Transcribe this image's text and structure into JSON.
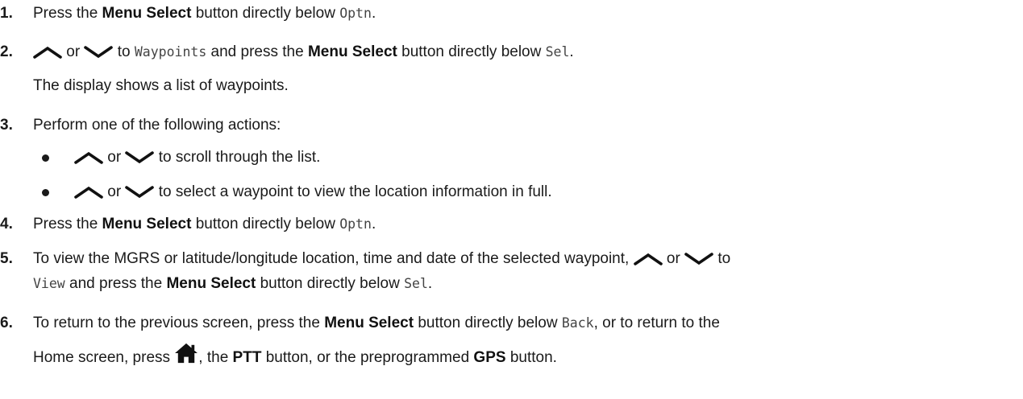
{
  "icons": {
    "up": "chevron-up-icon",
    "down": "chevron-down-icon",
    "home": "home-icon"
  },
  "steps": [
    {
      "number": "1.",
      "t1": "Press the ",
      "b1": "Menu Select",
      "t2": " button directly below ",
      "m1": "Optn",
      "t3": "."
    },
    {
      "number": "2.",
      "or": " or ",
      "t1": " to ",
      "m1": "Waypoints",
      "t2": " and press the ",
      "b1": "Menu Select",
      "t3": " button directly below ",
      "m2": "Sel",
      "t4": ".",
      "note": "The display shows a list of waypoints."
    },
    {
      "number": "3.",
      "text": "Perform one of the following actions:",
      "bullets": [
        {
          "or": " or ",
          "text": " to scroll through the list."
        },
        {
          "or": " or ",
          "text": " to select a waypoint to view the location information in full."
        }
      ]
    },
    {
      "number": "4.",
      "t1": "Press the ",
      "b1": "Menu Select",
      "t2": " button directly below ",
      "m1": "Optn",
      "t3": "."
    },
    {
      "number": "5.",
      "t1": "To view the MGRS or latitude/longitude location, time and date of the selected waypoint, ",
      "or": " or ",
      "t2": " to",
      "m1": "View",
      "t3": " and press the ",
      "b1": "Menu Select",
      "t4": " button directly below ",
      "m2": "Sel",
      "t5": "."
    },
    {
      "number": "6.",
      "t1": "To return to the previous screen, press the ",
      "b1": "Menu Select",
      "t2": " button directly below ",
      "m1": "Back",
      "t3": ", or to return to the",
      "t4": "Home screen, press ",
      "t5": ", the ",
      "b2": "PTT",
      "t6": " button, or the preprogrammed ",
      "b3": "GPS",
      "t7": " button."
    }
  ]
}
